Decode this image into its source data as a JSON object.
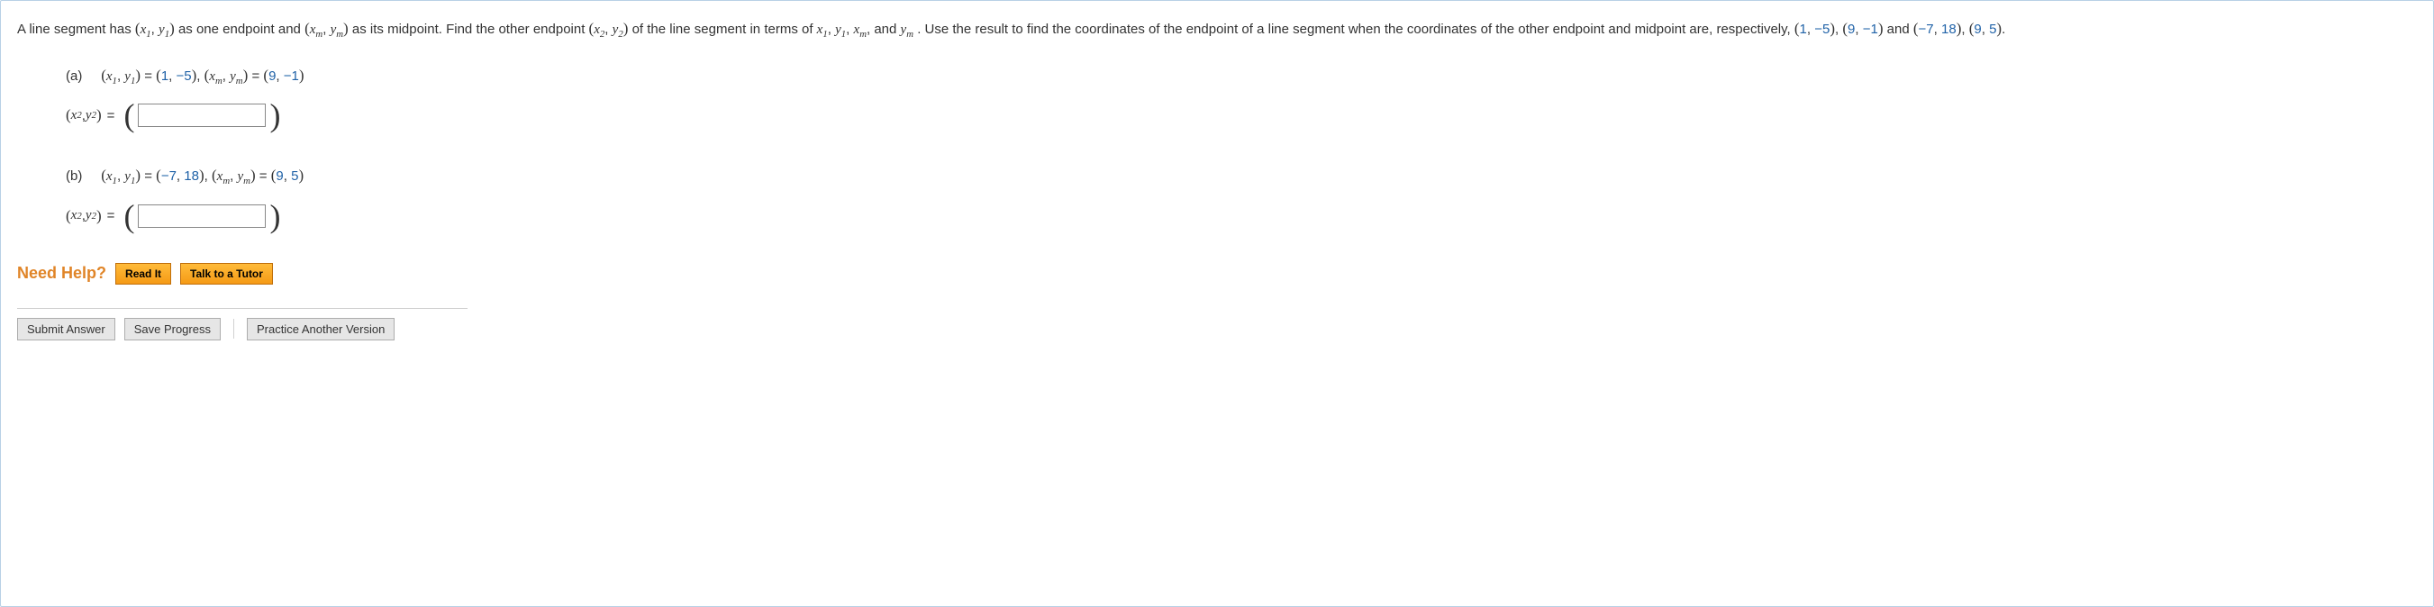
{
  "intro": {
    "t1": "A line segment has ",
    "pair1_open": "(",
    "x1": "x",
    "x1_sub": "1",
    "comma": ", ",
    "y1": "y",
    "y1_sub": "1",
    "pair_close": ")",
    "t2": " as one endpoint and ",
    "xm": "x",
    "xm_sub": "m",
    "ym": "y",
    "ym_sub": "m",
    "t3": " as its midpoint. Find the other endpoint ",
    "x2": "x",
    "x2_sub": "2",
    "y2": "y",
    "y2_sub": "2",
    "t4": " of the line segment in terms of ",
    "and": " and ",
    "t5": ". Use the result to find the coordinates of the endpoint of a line segment when the coordinates of the other endpoint and midpoint are, respectively, ",
    "point_a1": "(1, −5)",
    "sep": ",  ",
    "point_a2": "(9, −1)",
    "and2": " and ",
    "point_b1": "(−7, 18)",
    "point_b2": "(9, 5)",
    "period": "."
  },
  "part_a": {
    "label": "(a)",
    "prefix_x1y1": "x1, y1",
    "eq": " = ",
    "val1_open": "(",
    "val1_a": "1",
    "val1_b": "−5",
    "val1_close": ")",
    "prefix_xmym": "xm, ym",
    "val2_a": "9",
    "val2_b": "−1",
    "answer_prefix_x2y2": "x2, y2"
  },
  "part_b": {
    "label": "(b)",
    "val1_a": "−7",
    "val1_b": "18",
    "val2_a": "9",
    "val2_b": "5"
  },
  "help": {
    "label": "Need Help?",
    "read": "Read It",
    "tutor": "Talk to a Tutor"
  },
  "buttons": {
    "submit": "Submit Answer",
    "save": "Save Progress",
    "practice": "Practice Another Version"
  }
}
